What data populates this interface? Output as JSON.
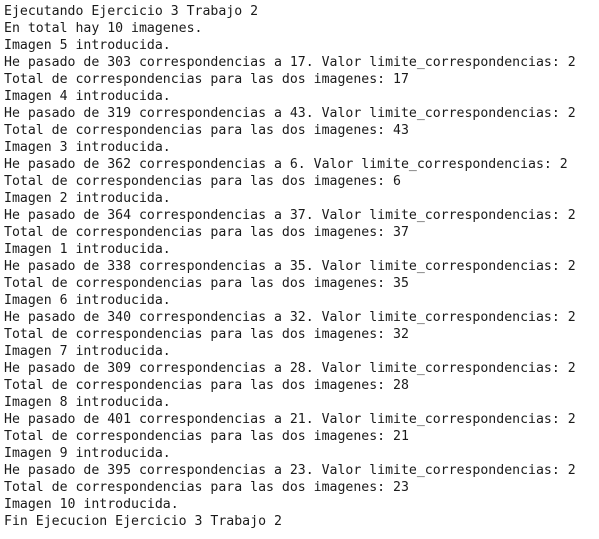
{
  "terminal": {
    "lines": [
      "Ejecutando Ejercicio 3 Trabajo 2",
      "En total hay 10 imagenes.",
      "Imagen 5 introducida.",
      "He pasado de 303 correspondencias a 17. Valor limite_correspondencias: 2",
      "Total de correspondencias para las dos imagenes: 17",
      "Imagen 4 introducida.",
      "He pasado de 319 correspondencias a 43. Valor limite_correspondencias: 2",
      "Total de correspondencias para las dos imagenes: 43",
      "Imagen 3 introducida.",
      "He pasado de 362 correspondencias a 6. Valor limite_correspondencias: 2",
      "Total de correspondencias para las dos imagenes: 6",
      "Imagen 2 introducida.",
      "He pasado de 364 correspondencias a 37. Valor limite_correspondencias: 2",
      "Total de correspondencias para las dos imagenes: 37",
      "Imagen 1 introducida.",
      "He pasado de 338 correspondencias a 35. Valor limite_correspondencias: 2",
      "Total de correspondencias para las dos imagenes: 35",
      "Imagen 6 introducida.",
      "He pasado de 340 correspondencias a 32. Valor limite_correspondencias: 2",
      "Total de correspondencias para las dos imagenes: 32",
      "Imagen 7 introducida.",
      "He pasado de 309 correspondencias a 28. Valor limite_correspondencias: 2",
      "Total de correspondencias para las dos imagenes: 28",
      "Imagen 8 introducida.",
      "He pasado de 401 correspondencias a 21. Valor limite_correspondencias: 2",
      "Total de correspondencias para las dos imagenes: 21",
      "Imagen 9 introducida.",
      "He pasado de 395 correspondencias a 23. Valor limite_correspondencias: 2",
      "Total de correspondencias para las dos imagenes: 23",
      "Imagen 10 introducida.",
      "Fin Ejecucion Ejercicio 3 Trabajo 2"
    ]
  }
}
